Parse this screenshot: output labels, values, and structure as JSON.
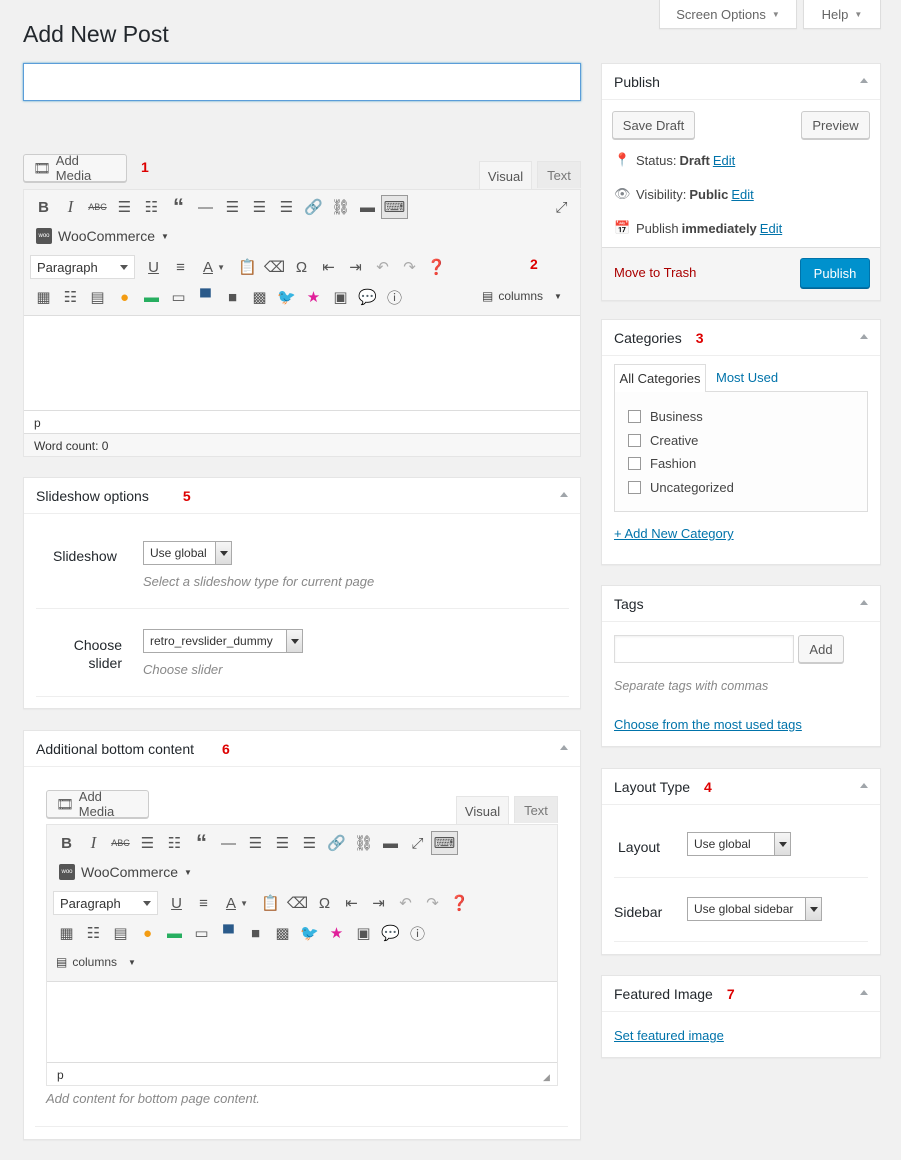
{
  "header": {
    "title": "Add New Post",
    "screen_options": "Screen Options",
    "help": "Help"
  },
  "title_input": {
    "value": "",
    "placeholder": ""
  },
  "editor": {
    "add_media": "Add Media",
    "tab_visual": "Visual",
    "tab_text": "Text",
    "woocommerce": "WooCommerce",
    "format": "Paragraph",
    "columns": "columns",
    "path": "p",
    "word_count": "Word count: 0"
  },
  "publish": {
    "title": "Publish",
    "save_draft": "Save Draft",
    "preview": "Preview",
    "status_label": "Status:",
    "status_value": "Draft",
    "visibility_label": "Visibility:",
    "visibility_value": "Public",
    "publish_label": "Publish",
    "publish_value": "immediately",
    "edit": "Edit",
    "trash": "Move to Trash",
    "publish_button": "Publish"
  },
  "categories": {
    "title": "Categories",
    "tab_all": "All Categories",
    "tab_most_used": "Most Used",
    "items": [
      "Business",
      "Creative",
      "Fashion",
      "Uncategorized"
    ],
    "add_new": "+ Add New Category"
  },
  "tags": {
    "title": "Tags",
    "add": "Add",
    "hint": "Separate tags with commas",
    "choose": "Choose from the most used tags"
  },
  "layout_type": {
    "title": "Layout Type",
    "layout_label": "Layout",
    "layout_value": "Use global",
    "sidebar_label": "Sidebar",
    "sidebar_value": "Use global sidebar"
  },
  "featured_image": {
    "title": "Featured Image",
    "link": "Set featured image"
  },
  "slideshow": {
    "title": "Slideshow options",
    "slideshow_label": "Slideshow",
    "slideshow_value": "Use global",
    "slideshow_hint": "Select a slideshow type for current page",
    "slider_label_1": "Choose",
    "slider_label_2": "slider",
    "slider_value": "retro_revslider_dummy",
    "slider_hint": "Choose slider"
  },
  "bottom": {
    "title": "Additional bottom content",
    "add_media": "Add Media",
    "tab_visual": "Visual",
    "tab_text": "Text",
    "woocommerce": "WooCommerce",
    "format": "Paragraph",
    "columns": "columns",
    "path": "p",
    "hint": "Add content for bottom page content."
  },
  "annotations": [
    "1",
    "2",
    "3",
    "4",
    "5",
    "6",
    "7"
  ],
  "colors": {
    "link": "#0073aa",
    "primary": "#0091cd",
    "trash": "#a00",
    "annotation": "#dd0000"
  }
}
